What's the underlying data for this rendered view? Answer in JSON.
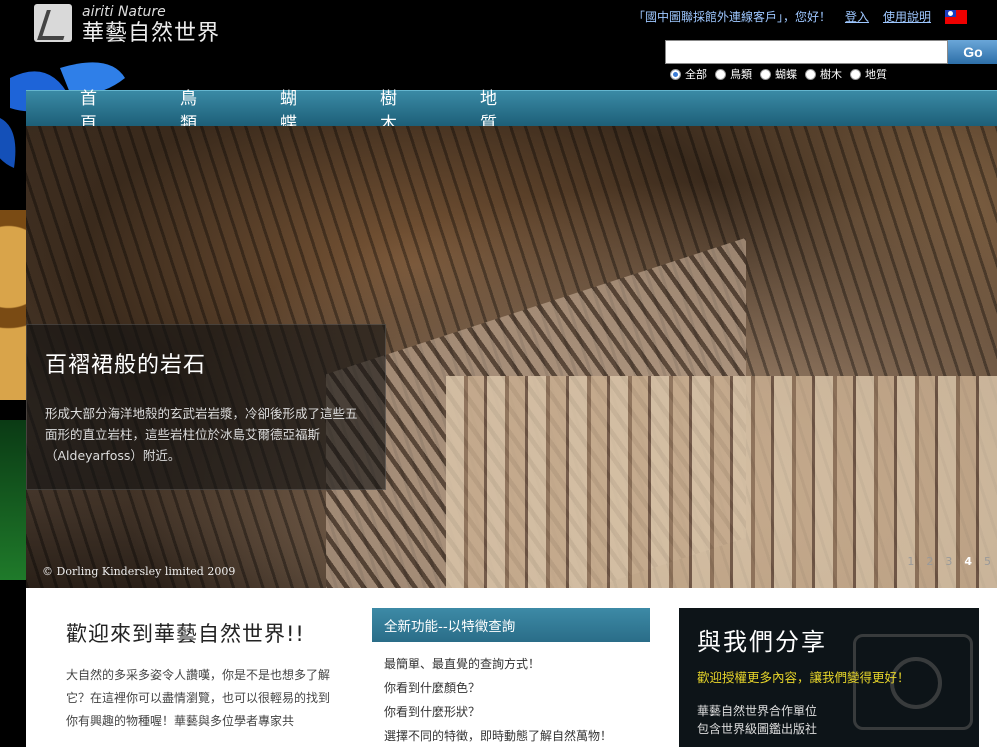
{
  "header": {
    "logo_en": "airiti Nature",
    "logo_zh": "華藝自然世界",
    "welcome": "「國中圖聯採館外連線客戶」，您好！",
    "login": "登入",
    "help": "使用說明"
  },
  "search": {
    "placeholder": "",
    "go_label": "Go",
    "options": [
      "全部",
      "鳥類",
      "蝴蝶",
      "樹木",
      "地質"
    ],
    "selected": "全部"
  },
  "nav": [
    "首 頁",
    "鳥 類",
    "蝴 蝶",
    "樹 木",
    "地 質"
  ],
  "hero": {
    "title": "百褶裙般的岩石",
    "text": "形成大部分海洋地殼的玄武岩岩漿，冷卻後形成了這些五面形的直立岩柱，這些岩柱位於冰島艾爾德亞福斯（Aldeyarfoss）附近。",
    "copyright": "© Dorling Kindersley limited 2009",
    "pages": [
      "1",
      "2",
      "3",
      "4",
      "5"
    ],
    "current_page": "4"
  },
  "welcome": {
    "title": "歡迎來到華藝自然世界!!",
    "text": "大自然的多采多姿令人讚嘆，你是不是也想多了解它？在這裡你可以盡情瀏覽，也可以很輕易的找到你有興趣的物種喔！華藝與多位學者專家共"
  },
  "feature": {
    "header": "全新功能--以特徵查詢",
    "items": [
      "最簡單、最直覺的查詢方式！",
      "你看到什麼顏色？",
      "你看到什麼形狀？",
      "選擇不同的特徵，即時動態了解自然萬物！"
    ]
  },
  "share": {
    "title": "與我們分享",
    "tagline": "歡迎授權更多內容，讓我們變得更好！",
    "line1": "華藝自然世界合作單位",
    "line2": "包含世界級圖鑑出版社"
  }
}
